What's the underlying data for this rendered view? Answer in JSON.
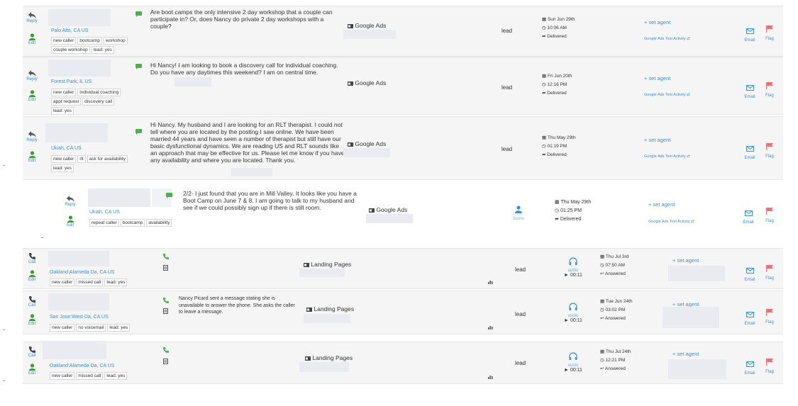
{
  "rows": [
    {
      "reply": "Reply",
      "edit": "Edit",
      "location": "Palo Alto, CA US",
      "tags": [
        "new caller",
        "bootcamp",
        "workshop",
        "couple workshop",
        "lead: yes"
      ],
      "message": "Are boot camps the only intensive 2 day workshop that a couple can participate in? Or, does Nancy do private 2 day workshops with a couple?",
      "source": "Google Ads",
      "lead": "lead",
      "date": "Sun Jun 29th",
      "time": "10:06 AM",
      "status": "Delivered",
      "agent": "+ set agent",
      "activity": "Google Ads Text Activity",
      "email": "Email",
      "flag": "Flag"
    },
    {
      "reply": "Reply",
      "edit": "Edit",
      "location": "Forest Park, IL US",
      "tags": [
        "new caller",
        "individual coaching",
        "appt request",
        "discovery call",
        "lead: yes"
      ],
      "message": "Hi Nancy! I am looking to book a discovery call for individual coaching. Do you have any daytimes this weekend? I am on central time.",
      "source": "Google Ads",
      "lead": "lead",
      "date": "Fri Jun 20th",
      "time": "12:16 PM",
      "status": "Delivered",
      "agent": "+ set agent",
      "activity": "Google Ads Text Activity",
      "email": "Email",
      "flag": "Flag"
    },
    {
      "reply": "Reply",
      "edit": "Edit",
      "location": "Ukiah, CA US",
      "tags": [
        "new caller",
        "rlt",
        "ask for availability",
        "lead: yes"
      ],
      "message": "Hi Nancy. My husband and I are looking for an RLT therapist. I could not tell where you are located by the posting I saw online. We have been married 44 years and have seen a number of therapist but still have our basic dysfunctional dynamics. We are reading US and RLT sounds like an approach that may be effective for us. Please let me know if you have any availability and where you are located. Thank you.",
      "source": "Google Ads",
      "lead": "lead",
      "date": "Thu May 29th",
      "time": "01:19 PM",
      "status": "Delivered",
      "agent": "+ set agent",
      "activity": "Google Ads Text Activity",
      "email": "Email",
      "flag": "Flag"
    },
    {
      "reply": "Reply",
      "edit": "Edit",
      "location": "Ukiah, CA US",
      "tags": [
        "repeat caller",
        "bootcamp",
        "availability"
      ],
      "message": "2/2- I just found that you are in Mill Valley. It looks like you have a Boot Camp on June 7 & 8. I am going to talk to my husband and see if we could possibly sign up if there is still room.",
      "source": "Google Ads",
      "score": "Score",
      "date": "Thu May 29th",
      "time": "01:25 PM",
      "status": "Delivered",
      "agent": "+ set agent",
      "activity": "Google Ads Text Activity",
      "email": "Email",
      "flag": "Flag"
    },
    {
      "call": "Call",
      "edit": "Edit",
      "location": "Oakland:Alameda Da, CA US",
      "tags": [
        "new caller",
        "missed call",
        "lead: yes"
      ],
      "message": "",
      "source": "Landing Pages",
      "lead": "lead",
      "audio": "audio",
      "duration": "00:11",
      "date": "Thu Jul 3rd",
      "time": "07:50 AM",
      "status": "Answered",
      "agent": "+ set agent",
      "email": "Email",
      "flag": "Flag"
    },
    {
      "call": "Call",
      "edit": "Edit",
      "location": "San Jose:West Da, CA US",
      "tags": [
        "new caller",
        "no voicemail",
        "lead: yes"
      ],
      "message": "Nancy Picard sent a message stating she is unavailable to answer the phone. She asks the caller to leave a message.",
      "source": "Landing Pages",
      "lead": "lead",
      "audio": "audio",
      "duration": "00:11",
      "date": "Tue Jun 24th",
      "time": "03:02 PM",
      "status": "Answered",
      "agent": "+ set agent",
      "email": "Email",
      "flag": "Flag"
    },
    {
      "call": "Call",
      "edit": "Edit",
      "location": "Oakland:Alameda Da, CA US",
      "tags": [
        "new caller",
        "missed call",
        "lead: yes"
      ],
      "message": "",
      "source": "Landing Pages",
      "lead": "lead",
      "audio": "audio",
      "duration": "00:11",
      "date": "Thu Jul 24th",
      "time": "12:21 PM",
      "status": "Answered",
      "agent": "+ set agent",
      "email": "Email",
      "flag": "Flag"
    }
  ],
  "colors": {
    "link": "#3a8fd8",
    "green": "#4caf50",
    "flag": "#e57373",
    "row_bg": "#f5f5f5"
  },
  "icons": [
    "reply-icon",
    "person-icon",
    "phone-icon",
    "sms-icon",
    "ad-icon",
    "calendar-icon",
    "clock-icon",
    "share-icon",
    "headphones-icon",
    "email-icon",
    "flag-icon",
    "chart-icon",
    "score-icon",
    "shuffle-icon"
  ]
}
